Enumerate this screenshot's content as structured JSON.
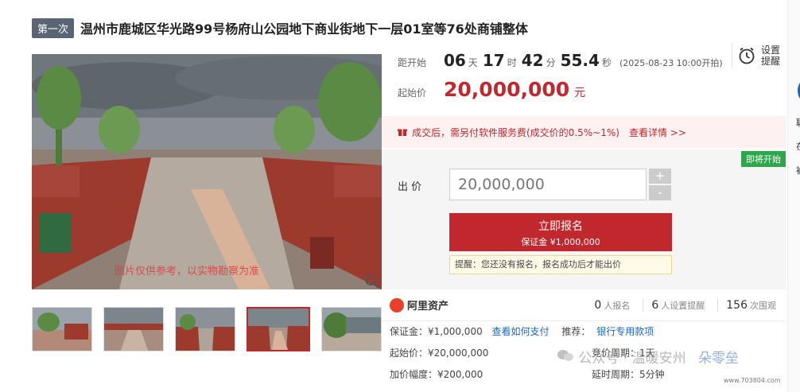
{
  "header": {
    "badge": "第一次",
    "title": "温州市鹿城区华光路99号杨府山公园地下商业街地下一层01室等76处商铺整体"
  },
  "image": {
    "watermark": "图片仅供参考，以实物勘察为准"
  },
  "countdown": {
    "label": "距开始",
    "days": "06",
    "days_unit": "天",
    "hours": "17",
    "hours_unit": "时",
    "minutes": "42",
    "minutes_unit": "分",
    "seconds": "55.4",
    "seconds_unit": "秒",
    "start_text": "(2025-08-23 10:00开拍)"
  },
  "remind": {
    "label": "设置提醒"
  },
  "start_price": {
    "label": "起始价",
    "value": "20,000,000",
    "unit": "元"
  },
  "notice": {
    "text": "成交后，需另付软件服务费(成交价的0.5%~1%)",
    "link": "查看详情 >>"
  },
  "bid": {
    "status_tag": "即将开始",
    "label": "出 价",
    "value": "20,000,000",
    "plus": "+",
    "minus": "-",
    "apply_main": "立即报名",
    "apply_sub": "保证金 ¥1,000,000",
    "tip": "提醒：您还没有报名，报名成功后才能出价"
  },
  "stats": {
    "brand": "阿里资产",
    "items": [
      {
        "num": "0",
        "label": "人报名"
      },
      {
        "num": "6",
        "label": "人设置提醒"
      },
      {
        "num": "156",
        "label": "次围观"
      }
    ]
  },
  "details": {
    "deposit": "保证金：¥1,000,000",
    "deposit_link": "查看如何支付",
    "recommend_label": "推荐：",
    "recommend_link": "银行专用款项",
    "start_price": "起始价：¥20,000,000",
    "cycle": "竞价周期：1天",
    "increment": "加价幅度：¥200,000",
    "extend": "延时周期：5分钟"
  },
  "overlay": {
    "wechat": "公众号 · 温暖安州",
    "brand": "朵零垒",
    "site": "www.703804.com"
  },
  "right_strip": {
    "items": [
      "联",
      "在",
      "被"
    ]
  }
}
